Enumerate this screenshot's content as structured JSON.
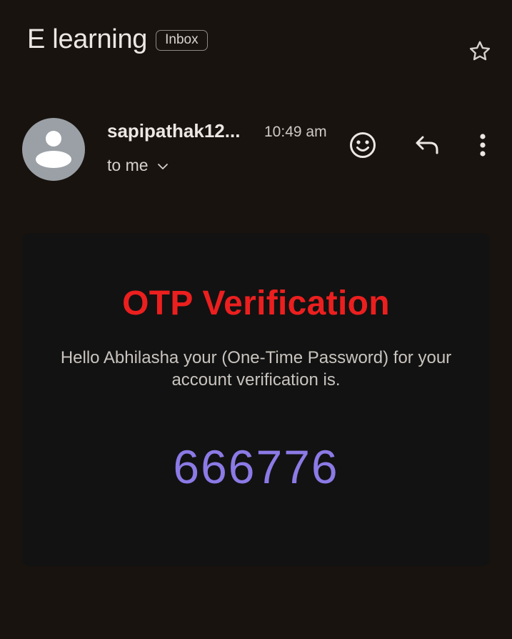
{
  "header": {
    "subject": "E learning",
    "label": "Inbox",
    "star_icon": "star-outline-icon"
  },
  "message": {
    "sender": "sapipathak12...",
    "time": "10:49 am",
    "recipient": "to me",
    "avatar_icon": "person-avatar-icon",
    "actions": {
      "emoji_icon": "add-reaction-icon",
      "reply_icon": "reply-icon",
      "more_icon": "more-vertical-icon"
    }
  },
  "body": {
    "title": "OTP Verification",
    "text": "Hello Abhilasha your (One-Time Password) for your account verification is.",
    "otp": "666776"
  },
  "colors": {
    "background": "#18130f",
    "card": "#121212",
    "title": "#ec1f1f",
    "otp": "#8c7ae6"
  }
}
